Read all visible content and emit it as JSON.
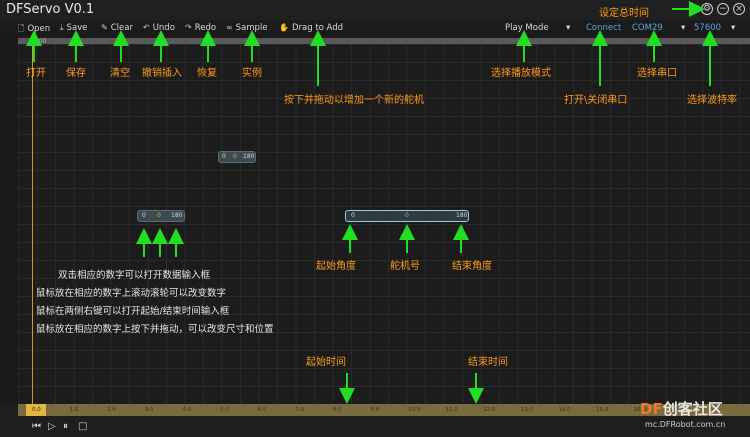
{
  "app": {
    "title": "DFServo V0.1",
    "settings_icon": "gear-icon",
    "minimize_icon": "minus-icon",
    "close_icon": "close-icon"
  },
  "toolbar": {
    "open": "Open",
    "save": "Save",
    "clear": "Clear",
    "undo": "Undo",
    "redo": "Redo",
    "sample": "Sample",
    "drag_to_add": "Drag to Add",
    "play_mode": "Play Mode",
    "connect": "Connect",
    "com_port": "COM29",
    "baud_rate": "57600"
  },
  "playhead": {
    "label": "0.00"
  },
  "servo_blocks": [
    {
      "start": "0",
      "id": "0",
      "end": "180"
    },
    {
      "start": "0",
      "id": "0",
      "end": "180"
    },
    {
      "start": "0",
      "id": "0",
      "end": "180"
    }
  ],
  "annotations": {
    "set_total_time": "设定总时间",
    "open": "打开",
    "save": "保存",
    "clear": "清空",
    "undo_insert": "撤销插入",
    "restore": "恢复",
    "example": "实例",
    "drag_add": "按下并拖动以增加一个新的舵机",
    "select_play_mode": "选择播放模式",
    "open_close_serial": "打开\\关闭串口",
    "select_serial": "选择串口",
    "select_baud": "选择波特率",
    "start_angle": "起始角度",
    "servo_number": "舵机号",
    "end_angle": "结束角度",
    "start_time": "起始时间",
    "end_time": "结束时间",
    "tips": [
      "双击相应的数字可以打开数据输入框",
      "鼠标放在相应的数字上滚动滚轮可以改变数字",
      "鼠标在两侧右键可以打开起始/结束时间输入框",
      "鼠标放在相应的数字上按下并拖动，可以改变尺寸和位置"
    ]
  },
  "timeline": {
    "ticks": [
      "0.0",
      "1.0",
      "2.0",
      "3.0",
      "4.0",
      "5.0",
      "6.0",
      "7.0",
      "8.0",
      "9.0",
      "10.0",
      "11.0",
      "12.0",
      "13.0",
      "14.0",
      "15.0",
      "16.0",
      "17.0"
    ]
  },
  "playback": {
    "prev_icon": "skip-back-icon",
    "play_icon": "play-icon",
    "pause_icon": "pause-icon",
    "stop_icon": "stop-icon"
  },
  "watermark": {
    "brand_df": "DF",
    "brand_cn": "创客社区",
    "url": "mc.DFRobot.com.cn"
  },
  "colors": {
    "annotation": "#ff9a1a",
    "arrow": "#22dd22",
    "playhead": "#d59a2a",
    "accent_blue": "#5aa8d8"
  }
}
